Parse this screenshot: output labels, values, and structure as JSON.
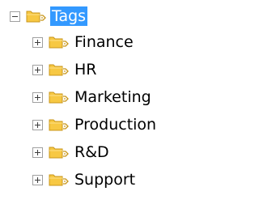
{
  "tree": {
    "root": {
      "label": "Tags",
      "expanded": true,
      "selected": true,
      "icon": "tag-folder-icon"
    },
    "children": [
      {
        "label": "Finance",
        "expanded": false,
        "icon": "tag-folder-icon"
      },
      {
        "label": "HR",
        "expanded": false,
        "icon": "tag-folder-icon"
      },
      {
        "label": "Marketing",
        "expanded": false,
        "icon": "tag-folder-icon"
      },
      {
        "label": "Production",
        "expanded": false,
        "icon": "tag-folder-icon"
      },
      {
        "label": "R&D",
        "expanded": false,
        "icon": "tag-folder-icon"
      },
      {
        "label": "Support",
        "expanded": false,
        "icon": "tag-folder-icon"
      }
    ]
  },
  "colors": {
    "selection": "#3399ff",
    "folder_fill": "#f7c843",
    "folder_edge": "#c8961a",
    "toggle_border": "#a0a0a0"
  }
}
